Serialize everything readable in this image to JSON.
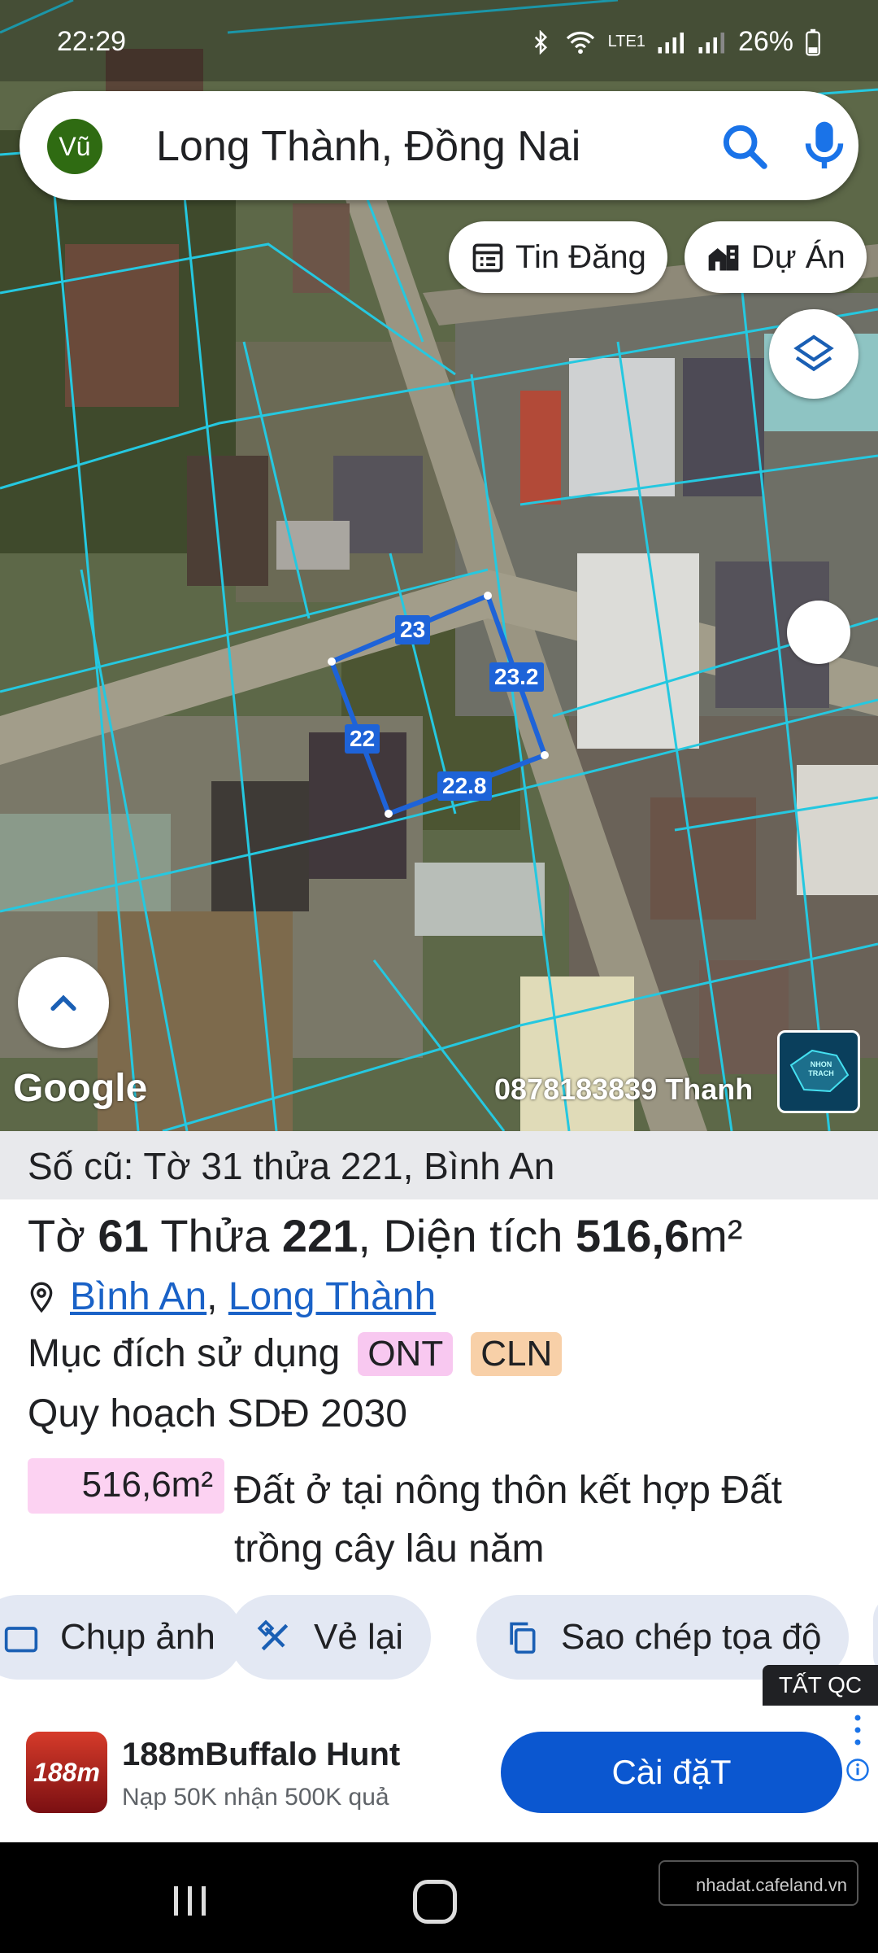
{
  "status_bar": {
    "time": "22:29",
    "battery": "26%",
    "signal_text": "LTE1"
  },
  "search": {
    "avatar": "Vũ",
    "query": "Long Thành, Đồng Nai"
  },
  "chips": {
    "listings": "Tin Đăng",
    "projects": "Dự Án"
  },
  "map": {
    "edge_labels": [
      "23",
      "23.2",
      "22.8",
      "22"
    ],
    "google_logo": "Google",
    "contact": "0878183839 Thanh",
    "thumb_text": "NHON TRACH"
  },
  "panel": {
    "old_number": "Số cũ: Tờ 31 thửa 221, Bình An",
    "title": {
      "sheet_label": "Tờ",
      "sheet": "61",
      "plot_label": "Thửa",
      "plot": "221",
      "area_label": ", Diện tích",
      "area": "516,6",
      "unit": "m²"
    },
    "location": {
      "ward": "Bình An",
      "separator": ",",
      "district": "Long Thành"
    },
    "purpose_label": "Mục đích sử dụng",
    "purpose_tags": [
      "ONT",
      "CLN"
    ],
    "plan_label": "Quy hoạch SDĐ 2030",
    "plan_area": "516,6m²",
    "plan_desc": "Đất ở tại nông thôn kết hợp Đất trồng cây lâu năm",
    "actions": {
      "photo": "Chụp ảnh",
      "redraw": "Vẻ lại",
      "copy": "Sao chép tọa độ"
    }
  },
  "ads_toggle": "TẤT QC",
  "ad": {
    "logo": "188m",
    "title": "188mBuffalo Hunt",
    "subtitle": "Nạp 50K nhận 500K quả",
    "button": "Cài đặT"
  },
  "watermark": "nhadat.cafeland.vn",
  "colors": {
    "parcel_line": "#25c8e0",
    "selected_plot": "#1e63d8",
    "ad_button": "#0b57d0"
  }
}
